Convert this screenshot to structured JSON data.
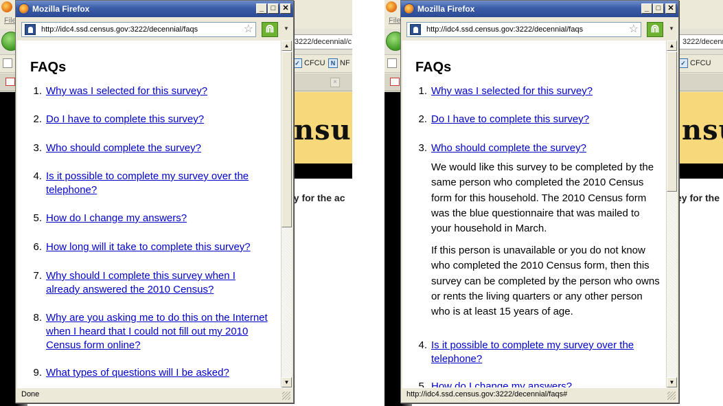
{
  "background": {
    "menu_file": "File",
    "url_fragment": "3222/decennial/c",
    "url_fragment_right": "3222/decenn",
    "bookmark_cfcu": "CFCU",
    "bookmark_nf": "NF",
    "bookmark_n_icon": "N",
    "banner_text": "nsus",
    "banner_text_right": "nsu",
    "snippet": "ey for the ac",
    "snippet_right": "ey for the"
  },
  "windows": [
    {
      "title": "Mozilla Firefox",
      "url": "http://idc4.ssd.census.gov:3222/decennial/faqs",
      "status": "Done",
      "heading": "FAQs"
    },
    {
      "title": "Mozilla Firefox",
      "url": "http://idc4.ssd.census.gov:3222/decennial/faqs",
      "status": "http://idc4.ssd.census.gov:3222/decennial/faqs#",
      "heading": "FAQs"
    }
  ],
  "faqs": [
    {
      "num": "1.",
      "q": "Why was I selected for this survey?"
    },
    {
      "num": "2.",
      "q": "Do I have to complete this survey?"
    },
    {
      "num": "3.",
      "q": "Who should complete the survey?",
      "answer_p1": "We would like this survey to be completed by the same person who completed the 2010 Census form for this household. The 2010 Census form was the blue questionnaire that was mailed to your household in March.",
      "answer_p2": "If this person is unavailable or you do not know who completed the 2010 Census form, then this survey can be completed by the person who owns or rents the living quarters or any other person who is at least 15 years of age."
    },
    {
      "num": "4.",
      "q": "Is it possible to complete my survey over the telephone?"
    },
    {
      "num": "5.",
      "q": "How do I change my answers?"
    },
    {
      "num": "6.",
      "q": "How long will it take to complete this survey?"
    },
    {
      "num": "7.",
      "q": "Why should I complete this survey when I already answered the 2010 Census?"
    },
    {
      "num": "8.",
      "q": "Why are you asking me to do this on the Internet when I heard that I could not fill out my 2010 Census form online?"
    },
    {
      "num": "9.",
      "q": "What types of questions will I be asked?"
    }
  ],
  "right_partial_item": {
    "num": "5.",
    "q": "How do I change my answers?"
  },
  "icons": [
    "firefox-icon",
    "site-identity-icon",
    "bookmark-star-icon",
    "greasemonkey-icon",
    "minimize-icon",
    "maximize-icon",
    "close-icon",
    "scroll-up-icon",
    "scroll-down-icon"
  ]
}
